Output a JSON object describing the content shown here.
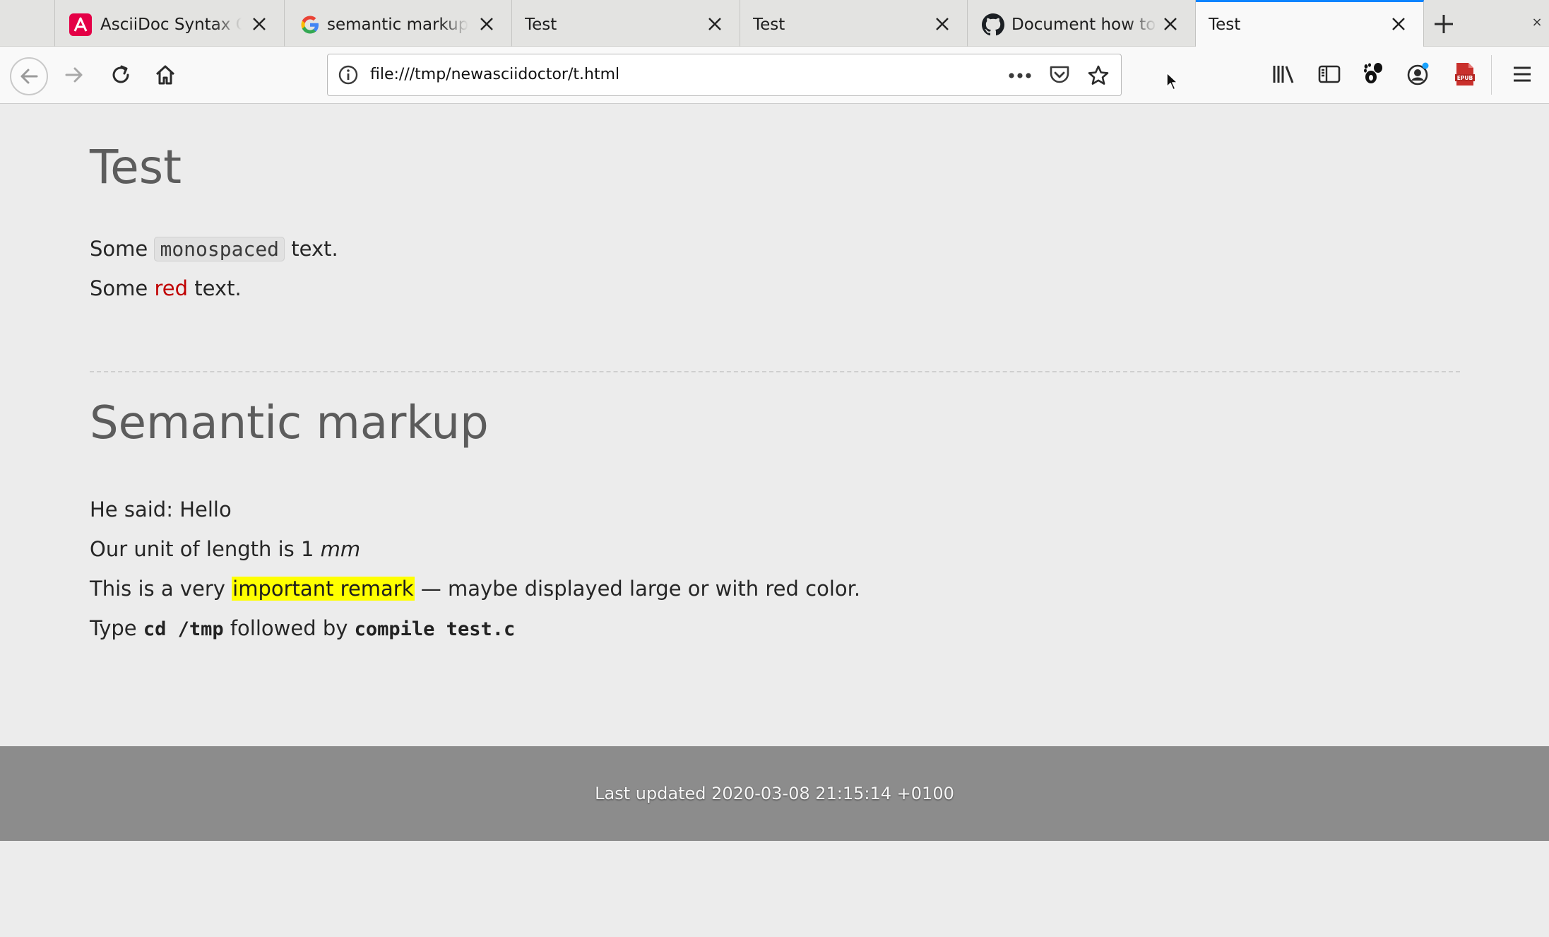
{
  "browser": {
    "tabs": [
      {
        "title": "AsciiDoc Syntax Quick Reference",
        "favicon": "asciidoc-icon",
        "active": false
      },
      {
        "title": "semantic markup latex",
        "favicon": "google-icon",
        "active": false
      },
      {
        "title": "Test",
        "favicon": "none",
        "active": false
      },
      {
        "title": "Test",
        "favicon": "none",
        "active": false
      },
      {
        "title": "Document how to override",
        "favicon": "github-icon",
        "active": false
      },
      {
        "title": "Test",
        "favicon": "none",
        "active": true
      }
    ],
    "url": "file:///tmp/newasciidoctor/t.html",
    "window_close": "×"
  },
  "colors": {
    "accent_tab": "#0a84ff",
    "red_text": "#c00000",
    "highlight": "#ffff00",
    "footer_bg": "#8c8c8c"
  },
  "page": {
    "title": "Test",
    "p1": {
      "before": "Some ",
      "mono": "monospaced",
      "after": " text."
    },
    "p2": {
      "before": "Some ",
      "red": "red",
      "after": " text."
    },
    "section_title": "Semantic markup",
    "p3": "He said: Hello",
    "p4": {
      "before": "Our unit of length is 1 ",
      "unit": "mm"
    },
    "p5": {
      "before": "This is a very ",
      "mark": "important remark",
      "after": " — maybe displayed large or with red color."
    },
    "p6": {
      "before": "Type ",
      "kbd1": "cd /tmp",
      "middle": " followed by ",
      "kbd2": "compile test.c"
    }
  },
  "footer": {
    "text": "Last updated 2020-03-08 21:15:14 +0100"
  }
}
